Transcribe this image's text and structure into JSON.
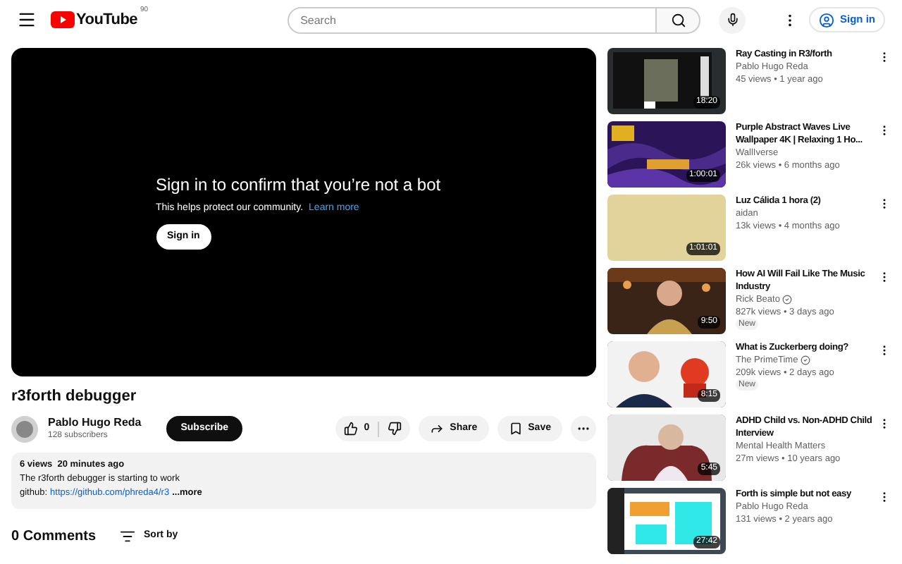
{
  "header": {
    "logo_text": "YouTube",
    "country_code": "90",
    "search": {
      "placeholder": "Search"
    },
    "sign_in": "Sign in"
  },
  "player": {
    "title": "Sign in to confirm that you’re not a bot",
    "message": "This helps protect our community.",
    "link": "Learn more",
    "button": "Sign in"
  },
  "video": {
    "title": "r3forth debugger",
    "channel": "Pablo Hugo Reda",
    "subscribers": "128 subscribers",
    "subscribe": "Subscribe",
    "likes": "0",
    "share": "Share",
    "save": "Save"
  },
  "description": {
    "stats": "6 views  20 minutes ago",
    "line": "The r3forth debugger is starting to work",
    "link_label": "github:",
    "link": "https://github.com/phreda4/r3",
    "more": "...more"
  },
  "comments": {
    "count": "0 Comments",
    "sort": "Sort by"
  },
  "recommendations": [
    {
      "title": "Ray Casting in R3/forth",
      "channel": "Pablo Hugo Reda",
      "verified": false,
      "stats": "45 views • 1 year ago",
      "duration": "18:20"
    },
    {
      "title": "Purple Abstract Waves Live Wallpaper 4K | Relaxing 1 Ho...",
      "channel": "WallIverse",
      "verified": false,
      "stats": "26k views • 6 months ago",
      "duration": "1:00:01"
    },
    {
      "title": "Luz Cálida 1 hora (2)",
      "channel": "aidan",
      "verified": false,
      "stats": "13k views • 4 months ago",
      "duration": "1:01:01"
    },
    {
      "title": "How AI Will Fail Like The Music Industry",
      "channel": "Rick Beato",
      "verified": true,
      "stats": "827k views • 3 days ago",
      "duration": "9:50",
      "badge": "New"
    },
    {
      "title": "What is Zuckerberg doing?",
      "channel": "The PrimeTime",
      "verified": true,
      "stats": "209k views • 2 days ago",
      "duration": "8:15",
      "badge": "New"
    },
    {
      "title": "ADHD Child vs. Non-ADHD Child Interview",
      "channel": "Mental Health Matters",
      "verified": false,
      "stats": "27m views • 10 years ago",
      "duration": "5:45"
    },
    {
      "title": "Forth is simple but not easy",
      "channel": "Pablo Hugo Reda",
      "verified": false,
      "stats": "131 views • 2 years ago",
      "duration": "27:42"
    }
  ]
}
